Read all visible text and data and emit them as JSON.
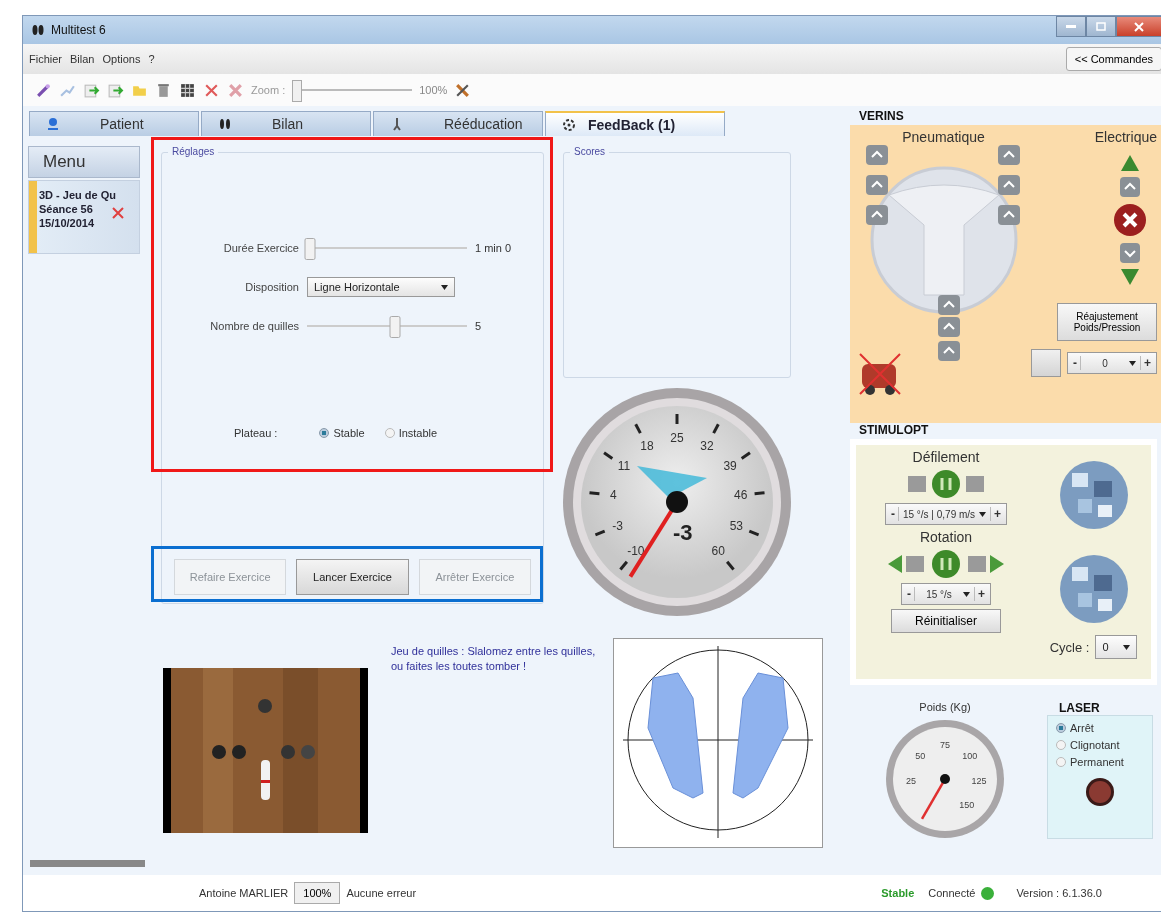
{
  "window": {
    "title": "Multitest 6"
  },
  "menu": [
    "Fichier",
    "Bilan",
    "Options",
    "?"
  ],
  "commands_button": "<< Commandes",
  "toolbar": {
    "zoom_label": "Zoom :",
    "zoom_slider": {
      "level": 0.0
    },
    "zoom_value": "100%"
  },
  "tabs": [
    {
      "label": "Patient",
      "selected": false,
      "kind": "person"
    },
    {
      "label": "Bilan",
      "selected": false,
      "kind": "feet"
    },
    {
      "label": "Rééducation",
      "selected": false,
      "kind": "exercise"
    },
    {
      "label": "FeedBack (1)",
      "selected": true,
      "kind": "target"
    }
  ],
  "sidebar": {
    "menu_button": "Menu",
    "session_lines": [
      "3D - Jeu de Qu",
      "Séance 56",
      "15/10/2014"
    ]
  },
  "settings": {
    "title": "Réglages",
    "duration": {
      "label": "Durée Exercice",
      "level": 0.02,
      "value": "1 min 0"
    },
    "layout": {
      "label": "Disposition",
      "value": "Ligne Horizontale"
    },
    "pins": {
      "label": "Nombre de quilles",
      "level": 0.55,
      "value": "5"
    },
    "plateau": {
      "label": "Plateau :",
      "options": [
        {
          "label": "Stable",
          "selected": true
        },
        {
          "label": "Instable",
          "selected": false
        }
      ]
    }
  },
  "actions": [
    {
      "label": "Refaire Exercice",
      "disabled": true
    },
    {
      "label": "Lancer Exercice",
      "disabled": false
    },
    {
      "label": "Arrêter Exercice",
      "disabled": true
    }
  ],
  "scores": {
    "title": "Scores"
  },
  "gauge": {
    "labels": [
      "-10",
      "-3",
      "4",
      "11",
      "18",
      "25",
      "32",
      "39",
      "46",
      "53",
      "60"
    ],
    "reading": "-3"
  },
  "exercise": {
    "description": "Jeu de quilles : Slalomez entre les quilles, ou faites les toutes tomber !"
  },
  "verins": {
    "title": "VERINS",
    "pneumatic_label": "Pneumatique",
    "electric_label": "Electrique",
    "readjust_button": "Réajustement Poids/Pression",
    "pressure": {
      "minus": "-",
      "value": "0",
      "plus": "+"
    }
  },
  "stimulopt": {
    "title": "STIMULOPT",
    "scroll": {
      "label": "Défilement",
      "minus": "-",
      "speed": "15 °/s | 0,79 m/s",
      "plus": "+"
    },
    "rotation": {
      "label": "Rotation",
      "minus": "-",
      "speed": "15 °/s",
      "plus": "+"
    },
    "reset_button": "Réinitialiser",
    "cycle": {
      "label": "Cycle :",
      "value": "0"
    }
  },
  "weight": {
    "title": "Poids (Kg)",
    "labels": [
      "25",
      "50",
      "75",
      "100",
      "125",
      "150"
    ]
  },
  "laser": {
    "title": "LASER",
    "options": [
      {
        "label": "Arrêt",
        "selected": true
      },
      {
        "label": "Clignotant",
        "selected": false
      },
      {
        "label": "Permanent",
        "selected": false
      }
    ]
  },
  "status_bar": {
    "user": "Antoine MARLIER",
    "zoom": "100%",
    "error": "Aucune erreur",
    "state": "Stable",
    "connection": "Connecté",
    "connected": true,
    "version": "Version : 6.1.36.0"
  }
}
